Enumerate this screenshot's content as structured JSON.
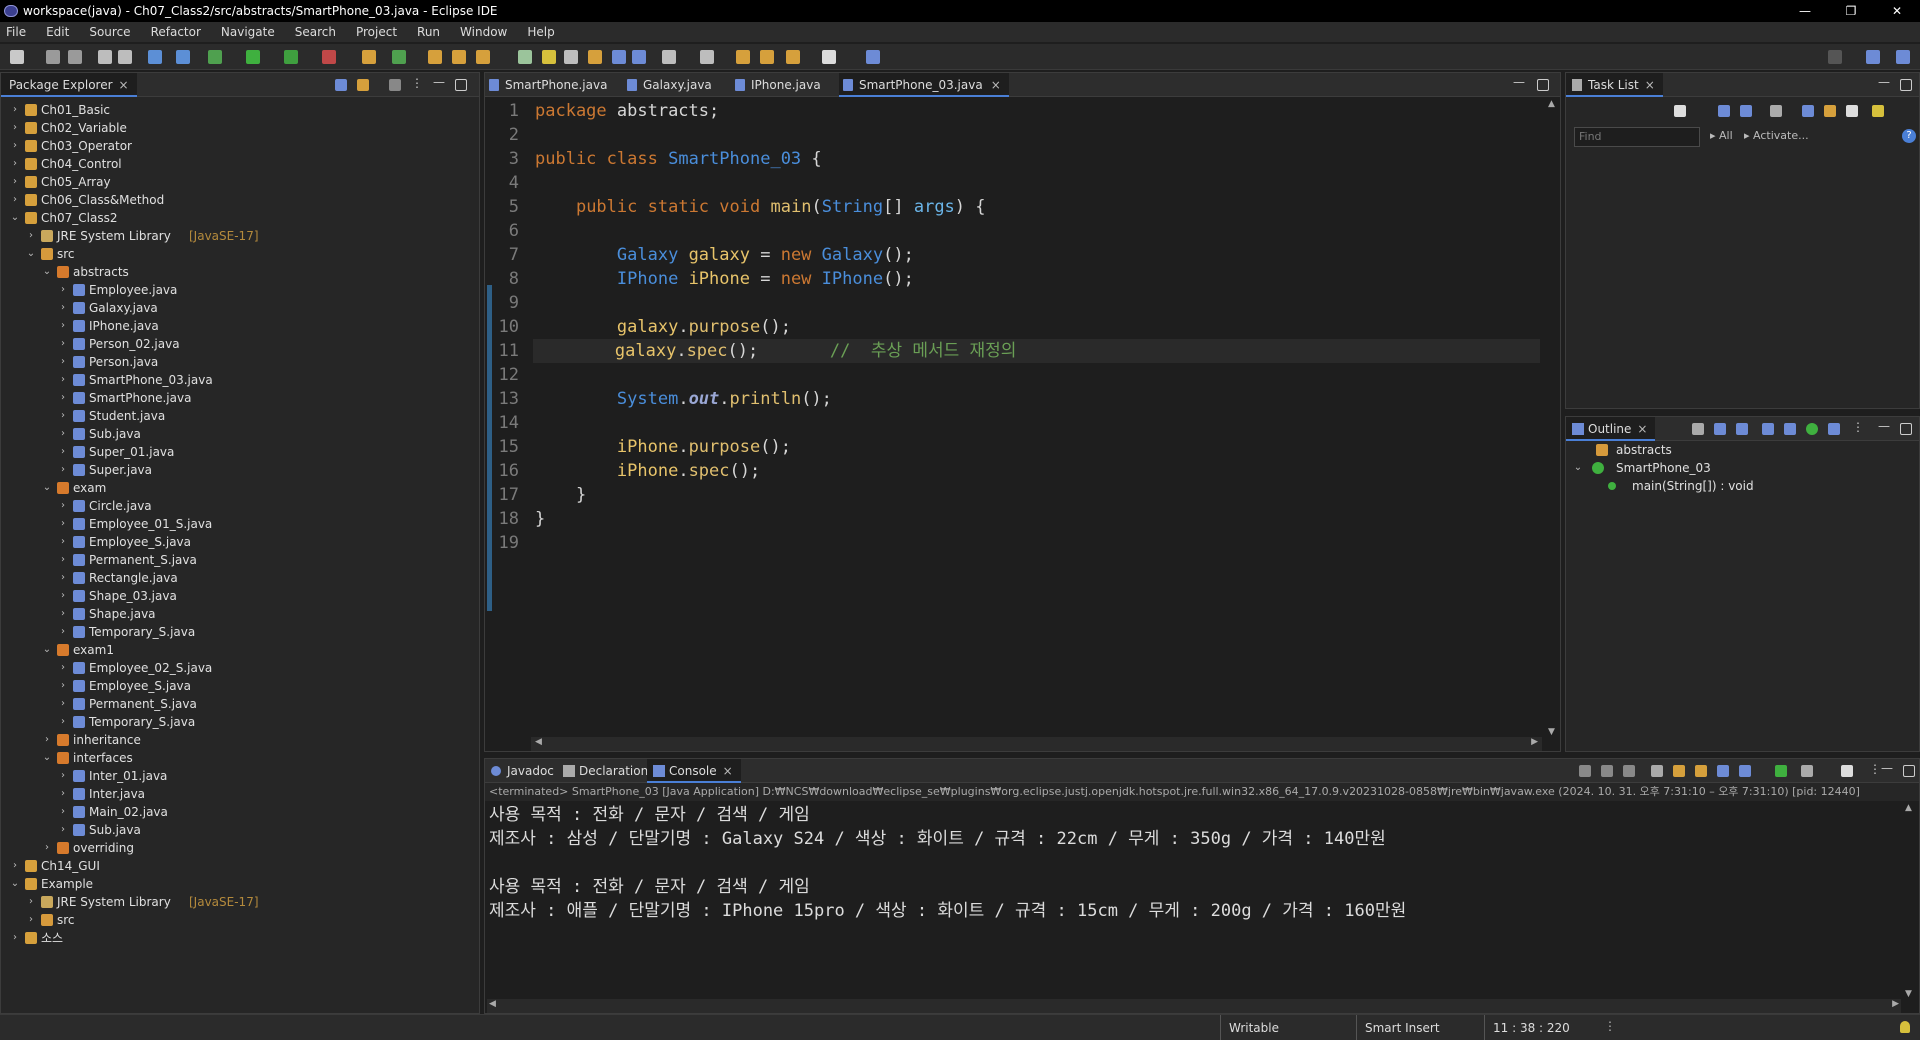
{
  "window": {
    "title": "workspace(java) - Ch07_Class2/src/abstracts/SmartPhone_03.java - Eclipse IDE",
    "controls": [
      "—",
      "❐",
      "✕"
    ]
  },
  "menu": [
    "File",
    "Edit",
    "Source",
    "Refactor",
    "Navigate",
    "Search",
    "Project",
    "Run",
    "Window",
    "Help"
  ],
  "package_explorer": {
    "title": "Package Explorer",
    "rows": [
      {
        "label": "Ch01_Basic",
        "sub": "",
        "arrow": "›",
        "icon": "project"
      },
      {
        "label": "Ch02_Variable",
        "sub": "",
        "arrow": "›",
        "icon": "project"
      },
      {
        "label": "Ch03_Operator",
        "sub": "",
        "arrow": "›",
        "icon": "project"
      },
      {
        "label": "Ch04_Control",
        "sub": "",
        "arrow": "›",
        "icon": "project"
      },
      {
        "label": "Ch05_Array",
        "sub": "",
        "arrow": "›",
        "icon": "project"
      },
      {
        "label": "Ch06_Class&Method",
        "sub": "",
        "arrow": "›",
        "icon": "project"
      },
      {
        "label": "Ch07_Class2",
        "sub": "",
        "arrow": "⌄",
        "icon": "project"
      },
      {
        "label": "JRE System Library",
        "sub": "[JavaSE-17]",
        "arrow": "›",
        "icon": "library"
      },
      {
        "label": "src",
        "sub": "",
        "arrow": "⌄",
        "icon": "folder"
      },
      {
        "label": "abstracts",
        "sub": "",
        "arrow": "⌄",
        "icon": "package"
      },
      {
        "label": "Employee.java",
        "sub": "",
        "arrow": "›",
        "icon": "java"
      },
      {
        "label": "Galaxy.java",
        "sub": "",
        "arrow": "›",
        "icon": "java"
      },
      {
        "label": "IPhone.java",
        "sub": "",
        "arrow": "›",
        "icon": "java"
      },
      {
        "label": "Person_02.java",
        "sub": "",
        "arrow": "›",
        "icon": "java"
      },
      {
        "label": "Person.java",
        "sub": "",
        "arrow": "›",
        "icon": "java"
      },
      {
        "label": "SmartPhone_03.java",
        "sub": "",
        "arrow": "›",
        "icon": "java"
      },
      {
        "label": "SmartPhone.java",
        "sub": "",
        "arrow": "›",
        "icon": "java"
      },
      {
        "label": "Student.java",
        "sub": "",
        "arrow": "›",
        "icon": "java"
      },
      {
        "label": "Sub.java",
        "sub": "",
        "arrow": "›",
        "icon": "java"
      },
      {
        "label": "Super_01.java",
        "sub": "",
        "arrow": "›",
        "icon": "java"
      },
      {
        "label": "Super.java",
        "sub": "",
        "arrow": "›",
        "icon": "java"
      },
      {
        "label": "exam",
        "sub": "",
        "arrow": "⌄",
        "icon": "package"
      },
      {
        "label": "Circle.java",
        "sub": "",
        "arrow": "›",
        "icon": "java"
      },
      {
        "label": "Employee_01_S.java",
        "sub": "",
        "arrow": "›",
        "icon": "java"
      },
      {
        "label": "Employee_S.java",
        "sub": "",
        "arrow": "›",
        "icon": "java"
      },
      {
        "label": "Permanent_S.java",
        "sub": "",
        "arrow": "›",
        "icon": "java"
      },
      {
        "label": "Rectangle.java",
        "sub": "",
        "arrow": "›",
        "icon": "java"
      },
      {
        "label": "Shape_03.java",
        "sub": "",
        "arrow": "›",
        "icon": "java"
      },
      {
        "label": "Shape.java",
        "sub": "",
        "arrow": "›",
        "icon": "java"
      },
      {
        "label": "Temporary_S.java",
        "sub": "",
        "arrow": "›",
        "icon": "java"
      },
      {
        "label": "exam1",
        "sub": "",
        "arrow": "⌄",
        "icon": "package"
      },
      {
        "label": "Employee_02_S.java",
        "sub": "",
        "arrow": "›",
        "icon": "java"
      },
      {
        "label": "Employee_S.java",
        "sub": "",
        "arrow": "›",
        "icon": "java"
      },
      {
        "label": "Permanent_S.java",
        "sub": "",
        "arrow": "›",
        "icon": "java"
      },
      {
        "label": "Temporary_S.java",
        "sub": "",
        "arrow": "›",
        "icon": "java"
      },
      {
        "label": "inheritance",
        "sub": "",
        "arrow": "›",
        "icon": "package"
      },
      {
        "label": "interfaces",
        "sub": "",
        "arrow": "⌄",
        "icon": "package"
      },
      {
        "label": "Inter_01.java",
        "sub": "",
        "arrow": "›",
        "icon": "java"
      },
      {
        "label": "Inter.java",
        "sub": "",
        "arrow": "›",
        "icon": "java"
      },
      {
        "label": "Main_02.java",
        "sub": "",
        "arrow": "›",
        "icon": "java"
      },
      {
        "label": "Sub.java",
        "sub": "",
        "arrow": "›",
        "icon": "java"
      },
      {
        "label": "overriding",
        "sub": "",
        "arrow": "›",
        "icon": "package"
      },
      {
        "label": "Ch14_GUI",
        "sub": "",
        "arrow": "›",
        "icon": "project"
      },
      {
        "label": "Example",
        "sub": "",
        "arrow": "⌄",
        "icon": "project"
      },
      {
        "label": "JRE System Library",
        "sub": "[JavaSE-17]",
        "arrow": "›",
        "icon": "library"
      },
      {
        "label": "src",
        "sub": "",
        "arrow": "›",
        "icon": "folder"
      },
      {
        "label": "소스",
        "sub": "",
        "arrow": "›",
        "icon": "project"
      }
    ]
  },
  "editor": {
    "tabs": [
      "SmartPhone.java",
      "Galaxy.java",
      "IPhone.java",
      "SmartPhone_03.java"
    ],
    "active_tab": "SmartPhone_03.java",
    "line_numbers": [
      "1",
      "2",
      "3",
      "4",
      "5",
      "6",
      "7",
      "8",
      "9",
      "10",
      "11",
      "12",
      "13",
      "14",
      "15",
      "16",
      "17",
      "18",
      "19"
    ],
    "lines": [
      [
        [
          "kw",
          "package"
        ],
        [
          "id",
          " abstracts;"
        ]
      ],
      [],
      [
        [
          "kw",
          "public"
        ],
        [
          "id",
          " "
        ],
        [
          "kw",
          "class"
        ],
        [
          "id",
          " "
        ],
        [
          "ty",
          "SmartPhone_03"
        ],
        [
          "id",
          " {"
        ]
      ],
      [],
      [
        [
          "id",
          "    "
        ],
        [
          "kw",
          "public"
        ],
        [
          "id",
          " "
        ],
        [
          "kw",
          "static"
        ],
        [
          "id",
          " "
        ],
        [
          "kw",
          "void"
        ],
        [
          "id",
          " "
        ],
        [
          "mt",
          "main"
        ],
        [
          "id",
          "("
        ],
        [
          "ty",
          "String"
        ],
        [
          "id",
          "[] "
        ],
        [
          "sv",
          "args"
        ],
        [
          "id",
          ") {"
        ]
      ],
      [],
      [
        [
          "id",
          "        "
        ],
        [
          "ty",
          "Galaxy"
        ],
        [
          "id",
          " "
        ],
        [
          "vr",
          "galaxy"
        ],
        [
          "id",
          " = "
        ],
        [
          "kw",
          "new"
        ],
        [
          "id",
          " "
        ],
        [
          "ty",
          "Galaxy"
        ],
        [
          "id",
          "();"
        ]
      ],
      [
        [
          "id",
          "        "
        ],
        [
          "ty",
          "IPhone"
        ],
        [
          "id",
          " "
        ],
        [
          "vr",
          "iPhone"
        ],
        [
          "id",
          " = "
        ],
        [
          "kw",
          "new"
        ],
        [
          "id",
          " "
        ],
        [
          "ty",
          "IPhone"
        ],
        [
          "id",
          "();"
        ]
      ],
      [],
      [
        [
          "id",
          "        "
        ],
        [
          "vr",
          "galaxy"
        ],
        [
          "id",
          "."
        ],
        [
          "mt",
          "purpose"
        ],
        [
          "id",
          "();"
        ]
      ],
      [
        [
          "id",
          "        "
        ],
        [
          "vr",
          "galaxy"
        ],
        [
          "id",
          "."
        ],
        [
          "mt",
          "spec"
        ],
        [
          "id",
          "();       "
        ],
        [
          "cm",
          "//  추상 메서드 재정의"
        ]
      ],
      [],
      [
        [
          "id",
          "        "
        ],
        [
          "ty",
          "System"
        ],
        [
          "id",
          "."
        ],
        [
          "st",
          "out"
        ],
        [
          "id",
          "."
        ],
        [
          "mt",
          "println"
        ],
        [
          "id",
          "();"
        ]
      ],
      [],
      [
        [
          "id",
          "        "
        ],
        [
          "vr",
          "iPhone"
        ],
        [
          "id",
          "."
        ],
        [
          "mt",
          "purpose"
        ],
        [
          "id",
          "();"
        ]
      ],
      [
        [
          "id",
          "        "
        ],
        [
          "vr",
          "iPhone"
        ],
        [
          "id",
          "."
        ],
        [
          "mt",
          "spec"
        ],
        [
          "id",
          "();"
        ]
      ],
      [
        [
          "id",
          "    }"
        ]
      ],
      [
        [
          "id",
          "}"
        ]
      ],
      []
    ]
  },
  "task_list": {
    "title": "Task List",
    "find_placeholder": "Find",
    "all": "All",
    "activate": "Activate..."
  },
  "outline": {
    "title": "Outline",
    "items": [
      {
        "label": "abstracts",
        "arrow": ""
      },
      {
        "label": "SmartPhone_03",
        "arrow": "⌄"
      },
      {
        "label": "main(String[]) : void",
        "arrow": ""
      }
    ]
  },
  "bottom_tabs": [
    "Javadoc",
    "Declaration",
    "Console"
  ],
  "active_bottom_tab": "Console",
  "console": {
    "info": "<terminated> SmartPhone_03 [Java Application] D:₩NCS₩download₩eclipse_se₩plugins₩org.eclipse.justj.openjdk.hotspot.jre.full.win32.x86_64_17.0.9.v20231028-0858₩jre₩bin₩javaw.exe  (2024. 10. 31. 오후 7:31:10 – 오후 7:31:10) [pid: 12440]",
    "lines": [
      "사용 목적 : 전화 / 문자 / 검색 / 게임",
      "제조사 : 삼성 / 단말기명 : Galaxy S24 / 색상 : 화이트 / 규격 : 22cm / 무게 : 350g / 가격 : 140만원",
      "",
      "사용 목적 : 전화 / 문자 / 검색 / 게임",
      "제조사 : 애플 / 단말기명 : IPhone 15pro / 색상 : 화이트 / 규격 : 15cm / 무게 : 200g / 가격 : 160만원"
    ]
  },
  "status": {
    "writable": "Writable",
    "insert_mode": "Smart Insert",
    "position": "11 : 38 : 220"
  },
  "colors": {
    "keyword": "#cc7832",
    "type": "#4a8edb",
    "variable": "#e8c46a",
    "comment": "#6a9f55",
    "accent": "#4a7fd6"
  }
}
